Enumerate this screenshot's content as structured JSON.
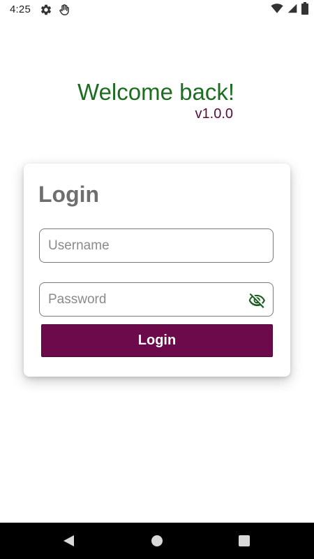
{
  "status_bar": {
    "time": "4:25",
    "left_icons": [
      "settings-gear-icon",
      "hand-touch-icon"
    ],
    "right_icons": [
      "wifi-icon",
      "cell-signal-icon",
      "battery-icon"
    ]
  },
  "welcome": {
    "title": "Welcome back!",
    "version": "v1.0.0"
  },
  "login_card": {
    "title": "Login",
    "username": {
      "placeholder": "Username",
      "value": ""
    },
    "password": {
      "placeholder": "Password",
      "value": "",
      "toggle_icon": "eye-off-icon"
    },
    "submit_label": "Login"
  },
  "nav_bar": {
    "buttons": [
      "back-triangle-icon",
      "home-circle-icon",
      "recents-square-icon"
    ]
  },
  "colors": {
    "welcome_title": "#1b6d1f",
    "version": "#5a0a3a",
    "card_title": "#6e6e6e",
    "button_bg": "#6c0a4c",
    "eye_icon": "#1b5e20",
    "nav_bar_bg": "#000000"
  }
}
